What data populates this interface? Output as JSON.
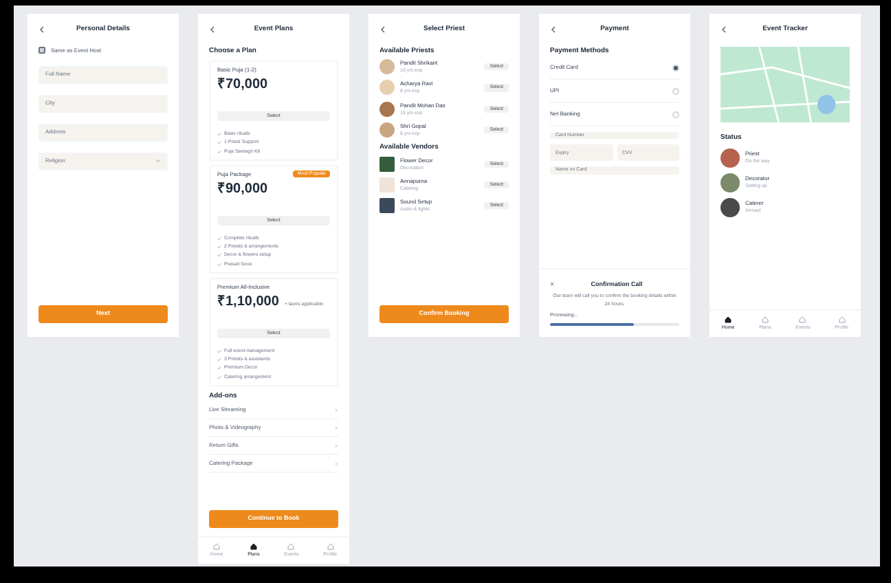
{
  "screens": [
    {
      "kind": "form",
      "title": "Personal Details",
      "checkbox": {
        "label": "Same as Event Host",
        "checked": false
      },
      "fields": [
        {
          "placeholder": "Full Name"
        },
        {
          "placeholder": "City"
        },
        {
          "placeholder": "Address"
        },
        {
          "placeholder": "Religion",
          "kind": "select"
        }
      ],
      "button": "Next"
    },
    {
      "kind": "plans",
      "title": "Event Plans",
      "heading": "Choose a Plan",
      "plans": [
        {
          "name": "Basic Puja (1-2)",
          "price": "₹70,000",
          "button": "Select",
          "features": [
            "Basic rituals",
            "1 Priest Support",
            "Puja Samagri Kit"
          ]
        },
        {
          "name": "Puja Package",
          "price": "₹90,000",
          "badge": "Most Popular",
          "button": "Select",
          "features": [
            "Complete rituals",
            "2 Priests & arrangements",
            "Decor & flowers setup",
            "Prasad Seva"
          ]
        },
        {
          "name": "Premium All-Inclusive",
          "price": "₹1,10,000",
          "note": "+ taxes applicable",
          "button": "Select",
          "features": [
            "Full event management",
            "3 Priests & assistants",
            "Premium Decor",
            "Catering arrangement"
          ]
        }
      ],
      "addons_title": "Add-ons",
      "addons": [
        "Live Streaming",
        "Photo & Videography",
        "Return Gifts",
        "Catering Package"
      ],
      "button": "Continue to Book",
      "nav": [
        {
          "label": "Home",
          "selected": false
        },
        {
          "label": "Plans",
          "selected": true
        },
        {
          "label": "Events",
          "selected": false
        },
        {
          "label": "Profile",
          "selected": false
        }
      ]
    },
    {
      "kind": "booking",
      "title": "Select Priest",
      "priests_title": "Available Priests",
      "priests": [
        {
          "name": "Pandit Shrikant",
          "sub": "10 yrs exp",
          "button": "Select"
        },
        {
          "name": "Acharya Ravi",
          "sub": "8 yrs exp",
          "button": "Select"
        },
        {
          "name": "Pandit Mohan Das",
          "sub": "15 yrs exp",
          "button": "Select"
        },
        {
          "name": "Shri Gopal",
          "sub": "6 yrs exp",
          "button": "Select"
        }
      ],
      "vendors_title": "Available Vendors",
      "vendors": [
        {
          "name": "Flower Decor",
          "sub": "Decoration",
          "button": "Select"
        },
        {
          "name": "Annapurna",
          "sub": "Catering",
          "button": "Select"
        },
        {
          "name": "Sound Setup",
          "sub": "Audio & lights",
          "button": "Select"
        }
      ],
      "button": "Confirm Booking"
    },
    {
      "kind": "payment",
      "title": "Payment",
      "heading": "Payment Methods",
      "methods": [
        {
          "label": "Credit Card",
          "selected": true
        },
        {
          "label": "UPI",
          "selected": false
        },
        {
          "label": "Net Banking",
          "selected": false
        }
      ],
      "fields": [
        "Card Number",
        "Expiry",
        "CVV",
        "Name on Card"
      ],
      "confirm_title": "Confirmation Call",
      "confirm_text": "Our team will call you to confirm the booking details within 24 hours.",
      "progress": {
        "label": "Processing...",
        "level": 0.65
      }
    },
    {
      "kind": "tracker",
      "title": "Event Tracker",
      "status_title": "Status",
      "people": [
        {
          "name": "Priest",
          "sub": "On the way"
        },
        {
          "name": "Decorator",
          "sub": "Setting up"
        },
        {
          "name": "Caterer",
          "sub": "Arrived"
        }
      ],
      "nav": [
        {
          "label": "Home",
          "selected": true
        },
        {
          "label": "Plans",
          "selected": false
        },
        {
          "label": "Events",
          "selected": false
        },
        {
          "label": "Profile",
          "selected": false
        }
      ]
    }
  ]
}
